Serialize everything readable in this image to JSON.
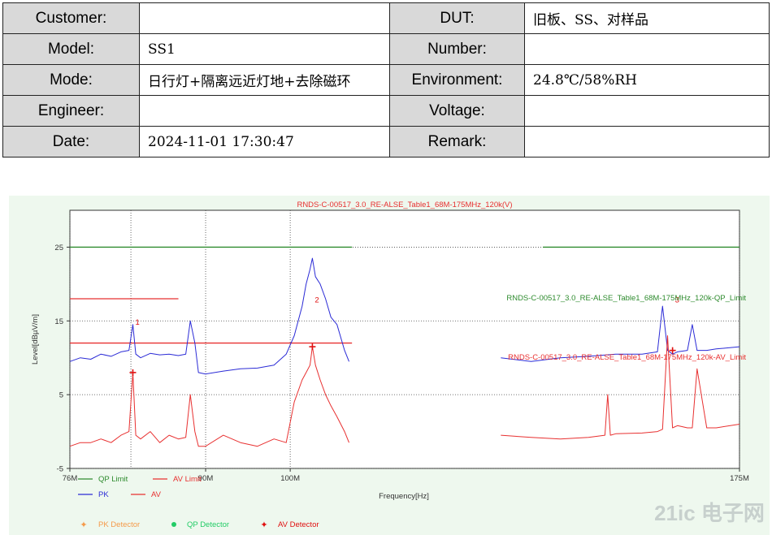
{
  "info_table": {
    "rows": [
      {
        "label1": "Customer:",
        "value1": "",
        "label2": "DUT:",
        "value2": "旧板、SS、对样品"
      },
      {
        "label1": "Model:",
        "value1": "SS1",
        "label2": "Number:",
        "value2": ""
      },
      {
        "label1": "Mode:",
        "value1": "日行灯+隔离远近灯地+去除磁环",
        "label2": "Environment:",
        "value2": "24.8℃/58%RH"
      },
      {
        "label1": "Engineer:",
        "value1": "",
        "label2": "Voltage:",
        "value2": ""
      },
      {
        "label1": "Date:",
        "value1": "2024-11-01 17:30:47",
        "label2": "Remark:",
        "value2": ""
      }
    ]
  },
  "chart_data": {
    "type": "line",
    "title": "RNDS-C-00517_3.0_RE-ALSE_Table1_68M-175MHz_120k(V)",
    "xlabel": "Frequency[Hz]",
    "ylabel": "Level[dBµV/m]",
    "xlim": [
      76,
      175
    ],
    "ylim": [
      -5,
      30
    ],
    "x_scale": "log",
    "x_ticks": [
      {
        "value": 76,
        "label": "76M"
      },
      {
        "value": 90,
        "label": "90M"
      },
      {
        "value": 100,
        "label": "100M"
      },
      {
        "value": 175,
        "label": "175M"
      }
    ],
    "x_gridlines": [
      76,
      82,
      90,
      100,
      175
    ],
    "y_ticks": [
      -5,
      5,
      15,
      25
    ],
    "grid": true,
    "colors": {
      "pk": "#2b2bd6",
      "av": "#e83030",
      "qp_limit": "#2e8b2e",
      "av_limit": "#e83030",
      "pk_detector": "#f59a4a",
      "qp_detector": "#22cc66",
      "av_detector": "#e01010",
      "axis": "#333333",
      "plot_bg": "#ffffff",
      "panel_bg": "#eef8ee"
    },
    "series": [
      {
        "name": "PK",
        "x": [
          76,
          77,
          78,
          79,
          80,
          81,
          81.8,
          82.2,
          82.5,
          83,
          84,
          85,
          86,
          87,
          87.8,
          88.3,
          88.8,
          89.2,
          90,
          92,
          94,
          96,
          98,
          99.5,
          100.5,
          101.5,
          102,
          102.5,
          102.8,
          103.2,
          103.8,
          104.5,
          105.2,
          106,
          107,
          107.6,
          130,
          135,
          140,
          145,
          150,
          155,
          158,
          159,
          160,
          161,
          162,
          164,
          165,
          166,
          168,
          170,
          175
        ],
        "y": [
          9.5,
          10,
          9.8,
          10.5,
          10.2,
          10.8,
          11,
          14.5,
          10.5,
          10,
          10.6,
          10.4,
          10.5,
          10.3,
          10.5,
          15,
          12,
          8,
          7.8,
          8.2,
          8.5,
          8.6,
          9,
          10.5,
          13,
          17,
          20,
          22,
          23.5,
          21,
          20,
          18,
          15.5,
          14.5,
          11,
          9.5,
          10,
          9.5,
          10,
          10.2,
          10.5,
          10.5,
          10.8,
          17,
          11,
          10.5,
          10.8,
          11,
          14.5,
          11,
          11,
          11.2,
          11.5
        ]
      },
      {
        "name": "AV",
        "x": [
          76,
          77,
          78,
          79,
          80,
          81,
          81.8,
          82.2,
          82.5,
          83,
          84,
          85,
          86,
          87,
          87.8,
          88.3,
          88.8,
          89.2,
          90,
          92,
          94,
          96,
          98,
          99.5,
          100.5,
          101.5,
          102,
          102.5,
          102.8,
          103.2,
          103.8,
          104.5,
          105.2,
          106,
          107,
          107.6,
          130,
          135,
          140,
          145,
          148,
          148.5,
          149,
          150,
          155,
          158,
          159,
          160,
          161,
          162,
          164,
          165,
          166,
          168,
          170,
          175
        ],
        "y": [
          -2,
          -1.5,
          -1.5,
          -1,
          -1.5,
          -0.5,
          0,
          8,
          -0.5,
          -1,
          0,
          -1.5,
          -0.5,
          -1,
          -0.8,
          5,
          0,
          -2,
          -2,
          -0.5,
          -1.5,
          -2,
          -1,
          -1.5,
          4,
          7,
          8,
          9,
          11.5,
          9,
          7,
          5,
          3.5,
          2,
          0,
          -1.5,
          -0.5,
          -0.8,
          -1,
          -0.8,
          -0.5,
          5,
          -0.5,
          -0.3,
          -0.2,
          0,
          0.3,
          13,
          0.5,
          0.8,
          0.5,
          0.5,
          8.5,
          0.5,
          0.5,
          1
        ]
      }
    ],
    "limits": [
      {
        "name": "QP Limit",
        "level": 25,
        "segments": [
          [
            76,
            108
          ],
          [
            137,
            175
          ]
        ]
      },
      {
        "name": "AV Limit",
        "level": 18,
        "segments": [
          [
            76,
            87
          ]
        ]
      },
      {
        "name": "AV Limit",
        "level": 12,
        "segments": [
          [
            76,
            108
          ]
        ]
      }
    ],
    "limit_labels": [
      {
        "text": "RNDS-C-00517_3.0_RE-ALSE_Table1_68M-175MHz_120k-QP_Limit"
      },
      {
        "text": "RNDS-C-00517_3.0_RE-ALSE_Table1_68M-175MHz_120k-AV_Limit"
      }
    ],
    "markers": [
      {
        "label": "1",
        "x": 82.2,
        "y": 8,
        "label_y": 14.5
      },
      {
        "label": "2",
        "x": 102.8,
        "y": 11.5,
        "label_y": 17.5
      },
      {
        "label": "3",
        "x": 161,
        "y": 11,
        "label_y": 17.5
      }
    ],
    "legend": {
      "placement": "bottom",
      "rows": [
        [
          {
            "name": "QP Limit",
            "color_key": "qp_limit"
          },
          {
            "name": "AV Limit",
            "color_key": "av_limit"
          }
        ],
        [
          {
            "name": "PK",
            "color_key": "pk"
          },
          {
            "name": "AV",
            "color_key": "av"
          }
        ]
      ],
      "detectors": [
        {
          "name": "PK Detector",
          "color_key": "pk_detector"
        },
        {
          "name": "QP Detector",
          "color_key": "qp_detector"
        },
        {
          "name": "AV Detector",
          "color_key": "av_detector"
        }
      ]
    }
  },
  "watermark": {
    "text": "21ic 电子网"
  }
}
